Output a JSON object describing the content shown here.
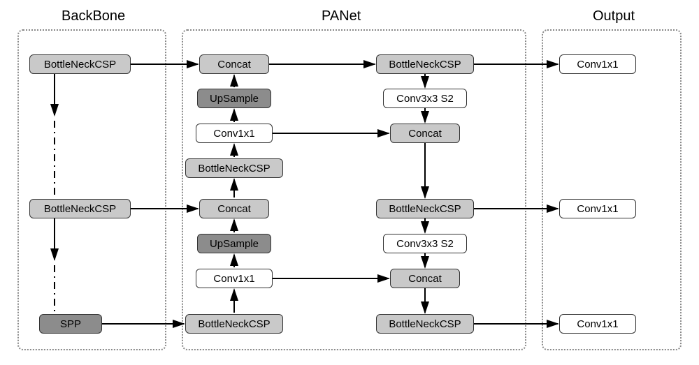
{
  "sections": {
    "backbone": {
      "title": "BackBone"
    },
    "panet": {
      "title": "PANet"
    },
    "output": {
      "title": "Output"
    }
  },
  "blocks": {
    "bb_csp_top": "BottleNeckCSP",
    "bb_csp_mid": "BottleNeckCSP",
    "bb_spp": "SPP",
    "p_concat_top": "Concat",
    "p_upsample_top": "UpSample",
    "p_conv1x1_top": "Conv1x1",
    "p_csp_mid": "BottleNeckCSP",
    "p_concat_mid": "Concat",
    "p_upsample_mid": "UpSample",
    "p_conv1x1_mid": "Conv1x1",
    "p_csp_bot": "BottleNeckCSP",
    "p2_csp_top": "BottleNeckCSP",
    "p2_conv3x3_top": "Conv3x3 S2",
    "p2_concat_top": "Concat",
    "p2_csp_mid": "BottleNeckCSP",
    "p2_conv3x3_mid": "Conv3x3 S2",
    "p2_concat_mid": "Concat",
    "p2_csp_bot": "BottleNeckCSP",
    "out_conv1": "Conv1x1",
    "out_conv2": "Conv1x1",
    "out_conv3": "Conv1x1"
  }
}
